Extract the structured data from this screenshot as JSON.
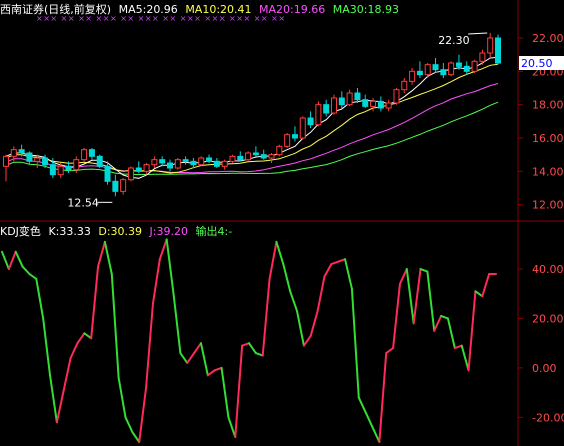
{
  "header": {
    "title": "西南证券(日线,前复权)",
    "indicators": [
      {
        "label": "MA5:20.96",
        "color": "#ffffff"
      },
      {
        "label": "MA10:20.41",
        "color": "#ffff50"
      },
      {
        "label": "MA20:19.66",
        "color": "#ff50ff"
      },
      {
        "label": "MA30:18.93",
        "color": "#50ff50"
      }
    ]
  },
  "price_axis": {
    "ticks": [
      "22.00",
      "20.00",
      "18.00",
      "16.00",
      "14.00",
      "12.00"
    ],
    "current_price": "20.50"
  },
  "annotations": {
    "high": "22.30",
    "low": "12.54",
    "markers": "××× ×× ×× ××× ×× ××× ×× ××× ××× ××× ×× ××"
  },
  "kdj_panel": {
    "title": "KDJ变色",
    "K": "K:33.33",
    "D": "D:30.39",
    "J": "J:39.20",
    "output": "输出4:-",
    "ticks": [
      "40.00",
      "20.00",
      "0.00",
      "-20.00"
    ]
  },
  "colors": {
    "up": "#ff3c3c",
    "down": "#00d8d8",
    "kdj_up": "#ff2a5a",
    "kdj_down": "#33dd33",
    "grid": "#8b0000",
    "ma5": "#ffffff",
    "ma10": "#ffff50",
    "ma20": "#ff50ff",
    "ma30": "#50ff50"
  },
  "chart_data": [
    {
      "type": "candlestick",
      "title": "西南证券(日线,前复权)",
      "ylim": [
        11.2,
        23.2
      ],
      "candles": [
        [
          14.3,
          15.0,
          13.4,
          14.9
        ],
        [
          14.9,
          15.5,
          14.6,
          15.3
        ],
        [
          15.3,
          15.6,
          14.9,
          15.1
        ],
        [
          15.1,
          15.2,
          14.4,
          14.6
        ],
        [
          14.6,
          15.0,
          14.2,
          14.8
        ],
        [
          14.8,
          15.0,
          14.2,
          14.4
        ],
        [
          14.4,
          14.8,
          13.6,
          13.8
        ],
        [
          13.8,
          14.5,
          13.6,
          14.3
        ],
        [
          14.3,
          14.6,
          13.9,
          14.1
        ],
        [
          14.1,
          14.9,
          13.9,
          14.7
        ],
        [
          14.7,
          15.4,
          14.6,
          15.3
        ],
        [
          15.3,
          15.4,
          14.7,
          14.9
        ],
        [
          14.9,
          15.0,
          14.2,
          14.3
        ],
        [
          14.3,
          14.6,
          13.2,
          13.4
        ],
        [
          13.4,
          13.8,
          12.5,
          12.8
        ],
        [
          12.8,
          13.6,
          12.6,
          13.5
        ],
        [
          13.5,
          14.3,
          13.4,
          14.2
        ],
        [
          14.2,
          14.6,
          13.9,
          14.0
        ],
        [
          14.0,
          14.5,
          13.8,
          14.4
        ],
        [
          14.4,
          14.9,
          14.2,
          14.7
        ],
        [
          14.7,
          14.9,
          14.3,
          14.5
        ],
        [
          14.5,
          14.7,
          14.0,
          14.2
        ],
        [
          14.2,
          14.8,
          14.1,
          14.7
        ],
        [
          14.7,
          14.9,
          14.4,
          14.6
        ],
        [
          14.6,
          14.8,
          14.2,
          14.4
        ],
        [
          14.4,
          14.9,
          14.3,
          14.8
        ],
        [
          14.8,
          15.0,
          14.5,
          14.6
        ],
        [
          14.6,
          14.8,
          14.2,
          14.3
        ],
        [
          14.3,
          14.7,
          14.1,
          14.6
        ],
        [
          14.6,
          15.0,
          14.5,
          14.9
        ],
        [
          14.9,
          15.2,
          14.6,
          14.7
        ],
        [
          14.7,
          15.2,
          14.6,
          15.1
        ],
        [
          15.1,
          15.5,
          14.9,
          15.0
        ],
        [
          15.0,
          15.3,
          14.7,
          14.8
        ],
        [
          14.8,
          15.1,
          14.5,
          15.0
        ],
        [
          15.0,
          15.6,
          14.9,
          15.5
        ],
        [
          15.5,
          16.3,
          15.4,
          16.2
        ],
        [
          16.2,
          16.7,
          15.8,
          16.0
        ],
        [
          16.0,
          17.3,
          15.9,
          17.2
        ],
        [
          17.2,
          17.6,
          16.6,
          16.8
        ],
        [
          16.8,
          18.2,
          16.7,
          18.0
        ],
        [
          18.0,
          18.3,
          17.3,
          17.5
        ],
        [
          17.5,
          18.6,
          17.4,
          18.4
        ],
        [
          18.4,
          18.8,
          17.8,
          18.0
        ],
        [
          18.0,
          18.9,
          17.9,
          18.7
        ],
        [
          18.7,
          19.0,
          18.1,
          18.3
        ],
        [
          18.3,
          18.6,
          17.8,
          17.9
        ],
        [
          17.9,
          18.4,
          17.6,
          18.2
        ],
        [
          18.2,
          18.5,
          17.6,
          17.8
        ],
        [
          17.8,
          18.3,
          17.6,
          18.1
        ],
        [
          18.1,
          19.0,
          18.0,
          18.9
        ],
        [
          18.9,
          19.6,
          18.7,
          19.4
        ],
        [
          19.4,
          20.2,
          19.2,
          20.0
        ],
        [
          20.0,
          20.6,
          19.6,
          19.8
        ],
        [
          19.8,
          20.5,
          19.6,
          20.4
        ],
        [
          20.4,
          20.8,
          19.9,
          20.1
        ],
        [
          20.1,
          20.5,
          19.6,
          19.8
        ],
        [
          19.8,
          20.6,
          19.7,
          20.5
        ],
        [
          20.5,
          21.0,
          20.1,
          20.3
        ],
        [
          20.3,
          20.6,
          19.8,
          20.0
        ],
        [
          20.0,
          20.7,
          19.9,
          20.6
        ],
        [
          20.6,
          21.3,
          20.4,
          21.1
        ],
        [
          21.1,
          22.3,
          20.8,
          22.0
        ],
        [
          22.0,
          22.2,
          20.4,
          20.5
        ]
      ],
      "ma": {
        "MA5": 20.96,
        "MA10": 20.41,
        "MA20": 19.66,
        "MA30": 18.93
      }
    },
    {
      "type": "line",
      "title": "KDJ变色",
      "ylim": [
        -30,
        55
      ],
      "series": [
        {
          "name": "J",
          "values": [
            47,
            40,
            47,
            41,
            38,
            36,
            20,
            -3,
            -22,
            -9,
            4,
            10,
            14,
            12,
            41,
            51,
            38,
            -4,
            -20,
            -26,
            -30,
            -8,
            26,
            44,
            52,
            30,
            6,
            2,
            6,
            10,
            -3,
            -1,
            0,
            -20,
            -28,
            9,
            10,
            6,
            5,
            36,
            51,
            42,
            31,
            23,
            9,
            13,
            23,
            37,
            42,
            43,
            44,
            32,
            -12,
            -18,
            -24,
            -30,
            6,
            8,
            34,
            40,
            18,
            40,
            39,
            15,
            21,
            20,
            8,
            9,
            -1,
            31,
            29,
            38,
            38
          ]
        }
      ]
    }
  ]
}
